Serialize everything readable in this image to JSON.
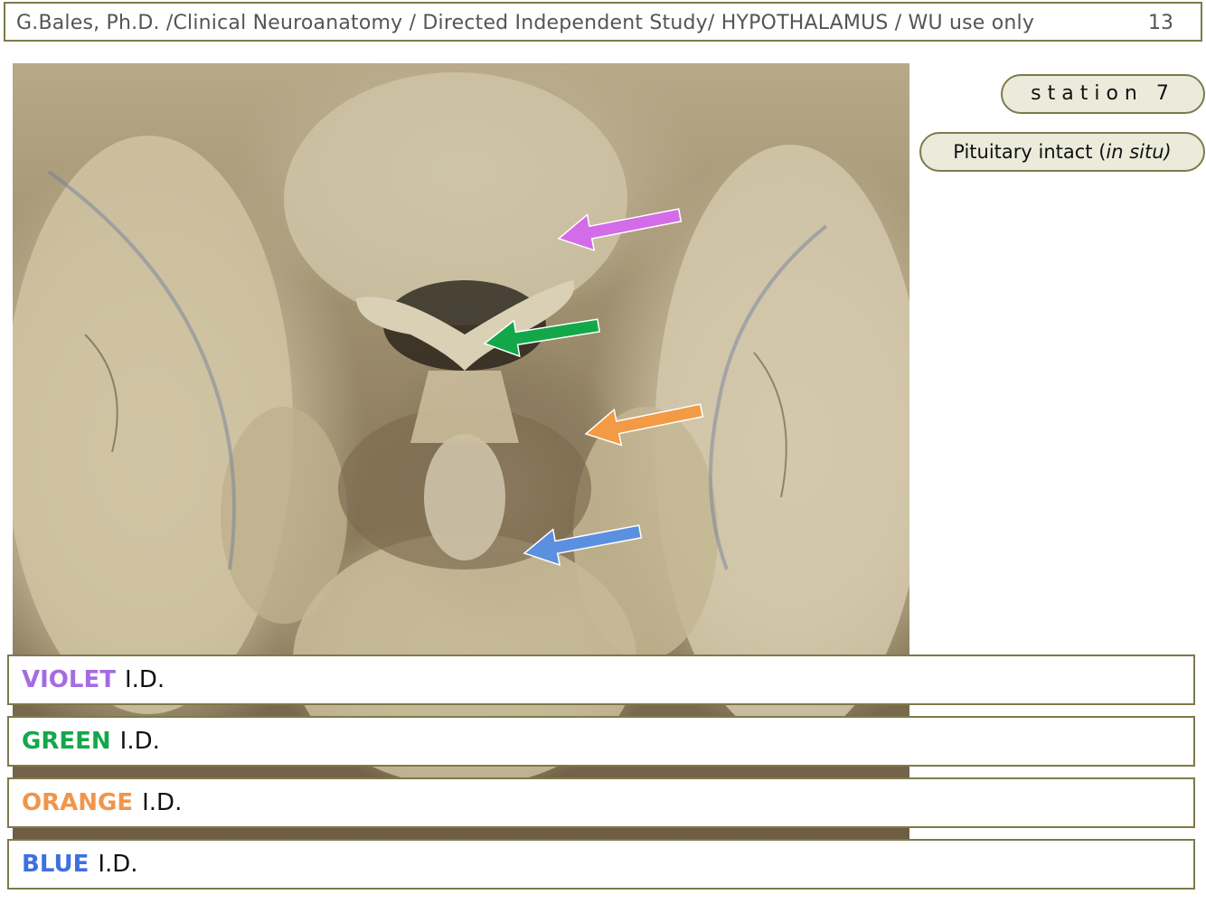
{
  "header": {
    "title": "G.Bales, Ph.D. /Clinical Neuroanatomy / Directed Independent  Study/ HYPOTHALAMUS / WU use only",
    "page_number": "13"
  },
  "badges": {
    "station": "station 7",
    "pituitary_prefix": "Pituitary intact (",
    "pituitary_italic": "in situ)"
  },
  "arrows": [
    {
      "name": "violet",
      "color": "#d36ce8"
    },
    {
      "name": "green",
      "color": "#12a84a"
    },
    {
      "name": "orange",
      "color": "#f39a45"
    },
    {
      "name": "blue",
      "color": "#5b8fe0"
    }
  ],
  "id_rows": [
    {
      "label": "VIOLET",
      "suffix": "I.D.",
      "color": "#a56ce0"
    },
    {
      "label": "GREEN",
      "suffix": "I.D.",
      "color": "#12a84a"
    },
    {
      "label": "ORANGE",
      "suffix": "I.D.",
      "color": "#f0954a"
    },
    {
      "label": "BLUE",
      "suffix": "I.D.",
      "color": "#3f6fe0"
    }
  ]
}
